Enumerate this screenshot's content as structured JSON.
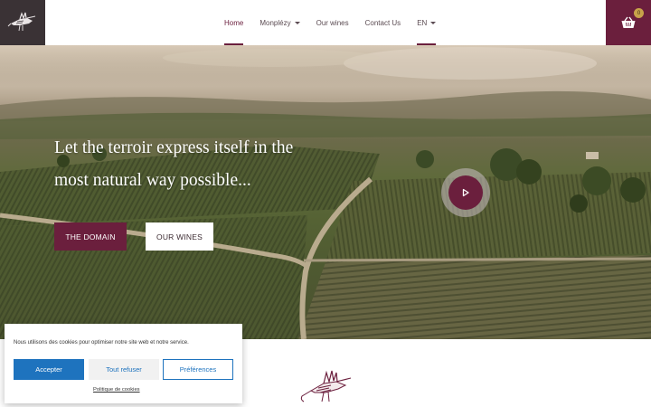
{
  "header": {
    "logo": "hoopoe-bird-logo",
    "nav": [
      {
        "label": "Home",
        "active": true,
        "dropdown": false
      },
      {
        "label": "Monplézy",
        "active": false,
        "dropdown": true
      },
      {
        "label": "Our wines",
        "active": false,
        "dropdown": false
      },
      {
        "label": "Contact Us",
        "active": false,
        "dropdown": false
      },
      {
        "label": "EN",
        "active": false,
        "dropdown": true
      }
    ],
    "cart": {
      "icon": "basket-icon",
      "count": "0"
    }
  },
  "hero": {
    "title_line1": "Let the terroir express itself in the",
    "title_line2": "most natural way possible...",
    "buttons": {
      "domain": "THE DOMAIN",
      "wines": "OUR WINES"
    },
    "video_button_icon": "play-icon"
  },
  "cookie_banner": {
    "text": "Nous utilisons des cookies pour optimiser notre site web et notre service.",
    "accept": "Accepter",
    "refuse": "Tout refuser",
    "preferences": "Préférences",
    "policy_link": "Politique de cookies"
  },
  "colors": {
    "brand": "#6b1f3d",
    "logo_bg": "#3a3235",
    "cookie_accent": "#1e73be",
    "badge": "#c8a34a"
  }
}
